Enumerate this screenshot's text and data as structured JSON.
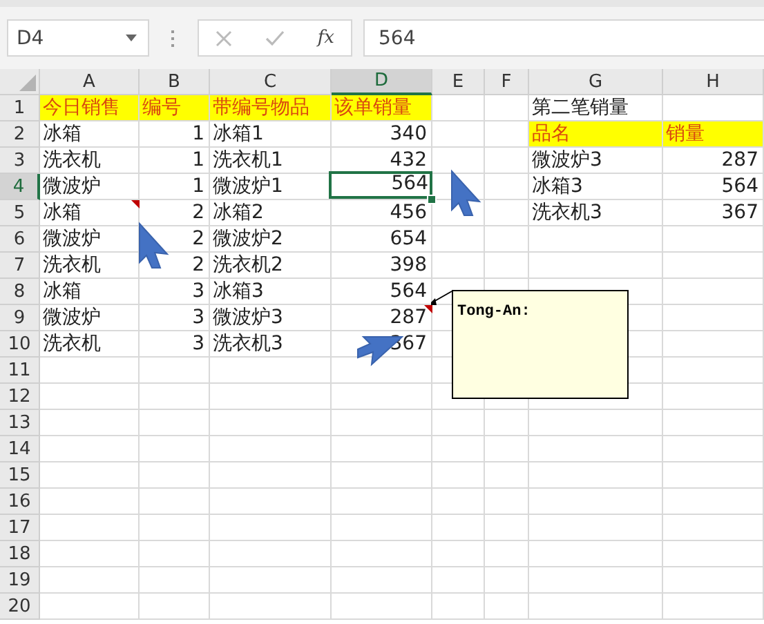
{
  "name_box": {
    "value": "D4"
  },
  "formula_bar": {
    "function_label": "fx",
    "value": "564"
  },
  "columns": [
    {
      "label": "A",
      "selected": false
    },
    {
      "label": "B",
      "selected": false
    },
    {
      "label": "C",
      "selected": false
    },
    {
      "label": "D",
      "selected": true
    },
    {
      "label": "E",
      "selected": false
    },
    {
      "label": "F",
      "selected": false
    },
    {
      "label": "G",
      "selected": false
    },
    {
      "label": "H",
      "selected": false
    }
  ],
  "rows": [
    {
      "number": "1",
      "selected": false,
      "cells": [
        {
          "text": "今日销售",
          "kind": "heading",
          "selected": false,
          "comment": false
        },
        {
          "text": "编号",
          "kind": "heading",
          "selected": false,
          "comment": false
        },
        {
          "text": "带编号物品",
          "kind": "heading",
          "selected": false,
          "comment": false
        },
        {
          "text": "该单销量",
          "kind": "heading",
          "selected": false,
          "comment": false
        },
        null,
        null,
        {
          "text": "第二笔销量",
          "kind": "text",
          "selected": false,
          "comment": false
        },
        null
      ]
    },
    {
      "number": "2",
      "selected": false,
      "cells": [
        {
          "text": "冰箱",
          "kind": "text",
          "selected": false,
          "comment": false
        },
        {
          "text": "1",
          "kind": "number",
          "selected": false,
          "comment": false
        },
        {
          "text": "冰箱1",
          "kind": "text",
          "selected": false,
          "comment": false
        },
        {
          "text": "340",
          "kind": "number",
          "selected": false,
          "comment": false
        },
        null,
        null,
        {
          "text": "品名",
          "kind": "heading",
          "selected": false,
          "comment": false
        },
        {
          "text": "销量",
          "kind": "heading",
          "selected": false,
          "comment": false
        }
      ]
    },
    {
      "number": "3",
      "selected": false,
      "cells": [
        {
          "text": "洗衣机",
          "kind": "text",
          "selected": false,
          "comment": false
        },
        {
          "text": "1",
          "kind": "number",
          "selected": false,
          "comment": false
        },
        {
          "text": "洗衣机1",
          "kind": "text",
          "selected": false,
          "comment": false
        },
        {
          "text": "432",
          "kind": "number",
          "selected": false,
          "comment": false
        },
        null,
        null,
        {
          "text": "微波炉3",
          "kind": "text",
          "selected": false,
          "comment": false
        },
        {
          "text": "287",
          "kind": "number",
          "selected": false,
          "comment": false
        }
      ]
    },
    {
      "number": "4",
      "selected": true,
      "cells": [
        {
          "text": "微波炉",
          "kind": "text",
          "selected": false,
          "comment": false
        },
        {
          "text": "1",
          "kind": "number",
          "selected": false,
          "comment": false
        },
        {
          "text": "微波炉1",
          "kind": "text",
          "selected": false,
          "comment": false
        },
        {
          "text": "564",
          "kind": "number",
          "selected": true,
          "comment": false
        },
        null,
        null,
        {
          "text": "冰箱3",
          "kind": "text",
          "selected": false,
          "comment": false
        },
        {
          "text": "564",
          "kind": "number",
          "selected": false,
          "comment": false
        }
      ]
    },
    {
      "number": "5",
      "selected": false,
      "cells": [
        {
          "text": "冰箱",
          "kind": "text",
          "selected": false,
          "comment": true
        },
        {
          "text": "2",
          "kind": "number",
          "selected": false,
          "comment": false
        },
        {
          "text": "冰箱2",
          "kind": "text",
          "selected": false,
          "comment": false
        },
        {
          "text": "456",
          "kind": "number",
          "selected": false,
          "comment": false
        },
        null,
        null,
        {
          "text": "洗衣机3",
          "kind": "text",
          "selected": false,
          "comment": false
        },
        {
          "text": "367",
          "kind": "number",
          "selected": false,
          "comment": false
        }
      ]
    },
    {
      "number": "6",
      "selected": false,
      "cells": [
        {
          "text": "微波炉",
          "kind": "text",
          "selected": false,
          "comment": false
        },
        {
          "text": "2",
          "kind": "number",
          "selected": false,
          "comment": false
        },
        {
          "text": "微波炉2",
          "kind": "text",
          "selected": false,
          "comment": false
        },
        {
          "text": "654",
          "kind": "number",
          "selected": false,
          "comment": false
        },
        null,
        null,
        null,
        null
      ]
    },
    {
      "number": "7",
      "selected": false,
      "cells": [
        {
          "text": "洗衣机",
          "kind": "text",
          "selected": false,
          "comment": false
        },
        {
          "text": "2",
          "kind": "number",
          "selected": false,
          "comment": false
        },
        {
          "text": "洗衣机2",
          "kind": "text",
          "selected": false,
          "comment": false
        },
        {
          "text": "398",
          "kind": "number",
          "selected": false,
          "comment": false
        },
        null,
        null,
        null,
        null
      ]
    },
    {
      "number": "8",
      "selected": false,
      "cells": [
        {
          "text": "冰箱",
          "kind": "text",
          "selected": false,
          "comment": false
        },
        {
          "text": "3",
          "kind": "number",
          "selected": false,
          "comment": false
        },
        {
          "text": "冰箱3",
          "kind": "text",
          "selected": false,
          "comment": false
        },
        {
          "text": "564",
          "kind": "number",
          "selected": false,
          "comment": false
        },
        null,
        null,
        null,
        null
      ]
    },
    {
      "number": "9",
      "selected": false,
      "cells": [
        {
          "text": "微波炉",
          "kind": "text",
          "selected": false,
          "comment": false
        },
        {
          "text": "3",
          "kind": "number",
          "selected": false,
          "comment": false
        },
        {
          "text": "微波炉3",
          "kind": "text",
          "selected": false,
          "comment": false
        },
        {
          "text": "287",
          "kind": "number",
          "selected": false,
          "comment": true
        },
        null,
        null,
        null,
        null
      ]
    },
    {
      "number": "10",
      "selected": false,
      "cells": [
        {
          "text": "洗衣机",
          "kind": "text",
          "selected": false,
          "comment": false
        },
        {
          "text": "3",
          "kind": "number",
          "selected": false,
          "comment": false
        },
        {
          "text": "洗衣机3",
          "kind": "text",
          "selected": false,
          "comment": false
        },
        {
          "text": "367",
          "kind": "number",
          "selected": false,
          "comment": false
        },
        null,
        null,
        null,
        null
      ]
    },
    {
      "number": "11",
      "selected": false,
      "cells": [
        null,
        null,
        null,
        null,
        null,
        null,
        null,
        null
      ]
    },
    {
      "number": "12",
      "selected": false,
      "cells": [
        null,
        null,
        null,
        null,
        null,
        null,
        null,
        null
      ]
    },
    {
      "number": "13",
      "selected": false,
      "cells": [
        null,
        null,
        null,
        null,
        null,
        null,
        null,
        null
      ]
    },
    {
      "number": "14",
      "selected": false,
      "cells": [
        null,
        null,
        null,
        null,
        null,
        null,
        null,
        null
      ]
    },
    {
      "number": "15",
      "selected": false,
      "cells": [
        null,
        null,
        null,
        null,
        null,
        null,
        null,
        null
      ]
    },
    {
      "number": "16",
      "selected": false,
      "cells": [
        null,
        null,
        null,
        null,
        null,
        null,
        null,
        null
      ]
    },
    {
      "number": "17",
      "selected": false,
      "cells": [
        null,
        null,
        null,
        null,
        null,
        null,
        null,
        null
      ]
    },
    {
      "number": "18",
      "selected": false,
      "cells": [
        null,
        null,
        null,
        null,
        null,
        null,
        null,
        null
      ]
    },
    {
      "number": "19",
      "selected": false,
      "cells": [
        null,
        null,
        null,
        null,
        null,
        null,
        null,
        null
      ]
    },
    {
      "number": "20",
      "selected": false,
      "cells": [
        null,
        null,
        null,
        null,
        null,
        null,
        null,
        null
      ]
    }
  ],
  "comment_box": {
    "author": "Tong-An:"
  }
}
